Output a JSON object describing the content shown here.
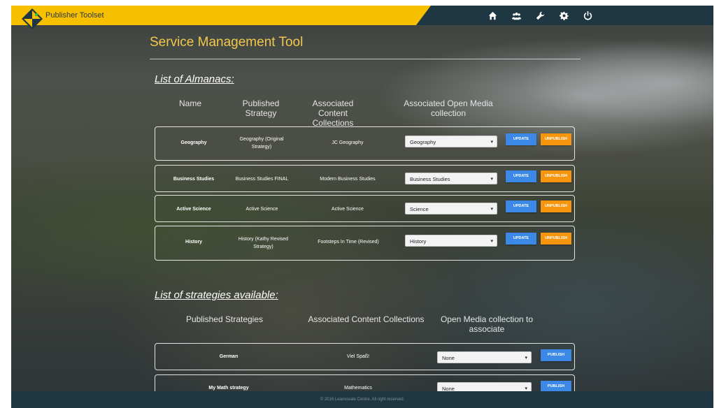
{
  "app": {
    "name": "Publisher Toolset"
  },
  "nav": {
    "icons": [
      "home-icon",
      "users-icon",
      "wrench-icon",
      "gear-icon",
      "power-icon"
    ]
  },
  "page": {
    "title": "Service Management Tool"
  },
  "almanacs": {
    "heading": "List of Almanacs:",
    "columns": {
      "name": "Name",
      "published_strategy": "Published Strategy",
      "content_collections": "Associated Content Collections",
      "open_media": "Associated Open Media collection"
    },
    "rows": [
      {
        "name": "Geography",
        "strategy": "Geography (Original Strategy)",
        "content": "JC Geography",
        "media": "Geography",
        "update": "UPDATE",
        "unpublish": "UNPUBLISH"
      },
      {
        "name": "Business Studies",
        "strategy": "Business Studies FINAL",
        "content": "Modern Business Studies",
        "media": "Business Studies",
        "update": "UPDATE",
        "unpublish": "UNPUBLISH"
      },
      {
        "name": "Active Science",
        "strategy": "Active Science",
        "content": "Active Science",
        "media": "Science",
        "update": "UPDATE",
        "unpublish": "UNPUBLISH"
      },
      {
        "name": "History",
        "strategy": "History (Kathy Revised Strategy)",
        "content": "Footsteps In Time (Revised)",
        "media": "History",
        "update": "UPDATE",
        "unpublish": "UNPUBLISH"
      }
    ]
  },
  "strategies": {
    "heading": "List of strategies available:",
    "columns": {
      "published": "Published Strategies",
      "content_collections": "Associated Content Collections",
      "open_media": "Open Media collection to associate"
    },
    "rows": [
      {
        "name": "German",
        "content": "Viel Spaß!",
        "media": "None",
        "publish": "PUBLISH"
      },
      {
        "name": "My Math strategy",
        "content": "Mathematics",
        "media": "None",
        "publish": "PUBLISH"
      }
    ]
  },
  "footer": {
    "text": "© 2016 Learnovate Centre. All right reserved."
  },
  "colors": {
    "accent_yellow": "#f6bf00",
    "navbar": "#1f3742",
    "update_blue": "#3b88e6",
    "unpublish_orange": "#f7950c",
    "title_gold": "#f1c84b"
  }
}
